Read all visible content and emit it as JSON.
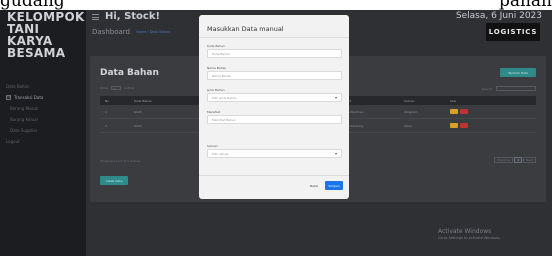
{
  "doc_strip": {
    "left_text": "gudang",
    "right_text": "panah"
  },
  "sidebar": {
    "brand_lines": [
      "KELOMPOK",
      "TANI",
      "KARYA",
      "BESAMA"
    ],
    "items": [
      {
        "label": "Data Bahan"
      },
      {
        "label": "Transaksi Data"
      },
      {
        "label": "Barang Masuk"
      },
      {
        "label": "Barang Keluar"
      },
      {
        "label": "Data Supplier"
      },
      {
        "label": "Logout"
      }
    ]
  },
  "topbar": {
    "greeting": "Hi, Stock!",
    "page_title": "Dashboard",
    "breadcrumb": "Home / Data Bahan",
    "date": "Selasa, 6 Juni 2023",
    "logo": "LOGISTICS"
  },
  "card": {
    "title": "Data Bahan",
    "add_button": "Tambah Data",
    "show_label": "Show",
    "show_value": "10",
    "entries_label": "entries",
    "search_label": "Search:",
    "columns": [
      "No",
      "Kode Bahan",
      "Merk",
      "Satuan",
      "Aksi"
    ],
    "rows": [
      {
        "no": "1",
        "kode": "K123",
        "merk": "Alfa Harimau",
        "satuan": "Kilogram"
      },
      {
        "no": "2",
        "kode": "K124",
        "merk": "Alfa Kantong",
        "satuan": "Tabel"
      }
    ],
    "showing": "Showing 1 to 2 of 2 entries",
    "pager": {
      "prev": "Previous",
      "page": "1",
      "next": "Next"
    },
    "print_button": "Cetak Data"
  },
  "modal": {
    "title": "Masukkan Data manual",
    "fields": [
      {
        "label": "Kode Bahan",
        "placeholder": "Kode Bahan"
      },
      {
        "label": "Nama Bahan",
        "placeholder": "Nama Bahan"
      },
      {
        "label": "Jenis Bahan",
        "placeholder": "Pilih Jenis Bahan"
      },
      {
        "label": "Merk/Ket",
        "placeholder": "Merk/Ket Bahan"
      },
      {
        "label": "Satuan",
        "placeholder": "Pilih satuan"
      }
    ],
    "close_button": "Batal",
    "save_button": "Simpan"
  },
  "watermark": {
    "line1": "Activate Windows",
    "line2": "Go to Settings to activate Windows."
  },
  "colors": {
    "sidebar_bg": "#1c1d20",
    "screen_bg": "#2e3033",
    "teal_button": "#2f8a8a",
    "edit": "#d8a21e",
    "delete": "#c23232",
    "primary": "#1877ef"
  }
}
